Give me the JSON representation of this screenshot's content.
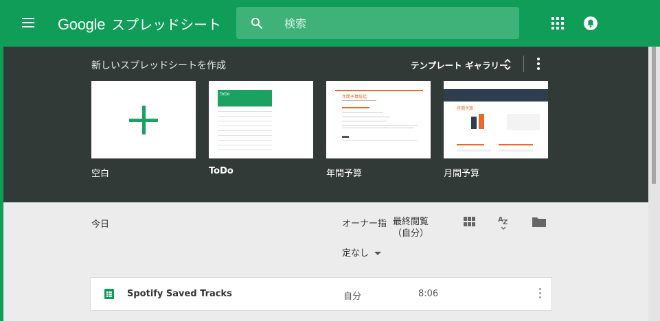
{
  "header": {
    "brand_google": "Google",
    "brand_product": "スプレッドシート",
    "search_placeholder": "検索",
    "brand_color": "#0f9d58"
  },
  "gallery": {
    "title": "新しいスプレッドシートを作成",
    "template_gallery_label": "テンプレート ギャラリー",
    "templates": [
      {
        "label": "空白",
        "thumb": "plus-icon"
      },
      {
        "label": "ToDo",
        "thumb": "todo-preview"
      },
      {
        "label": "年間予算",
        "thumb": "annual-budget-preview"
      },
      {
        "label": "月間予算",
        "thumb": "monthly-budget-preview"
      }
    ],
    "todo_thumb_title": "ToDo",
    "annual_thumb_title": "年間予算総括",
    "monthly_thumb_title": "月間予算",
    "background_color": "#323a38"
  },
  "list": {
    "section_label": "今日",
    "owner_header": "オーナー指",
    "last_viewed_header": "最終閲覧\n（自分）",
    "owner_filter": "定なし",
    "files": [
      {
        "name": "Spotify Saved Tracks",
        "owner": "自分",
        "time": "8:06",
        "icon": "sheets-icon"
      }
    ]
  }
}
